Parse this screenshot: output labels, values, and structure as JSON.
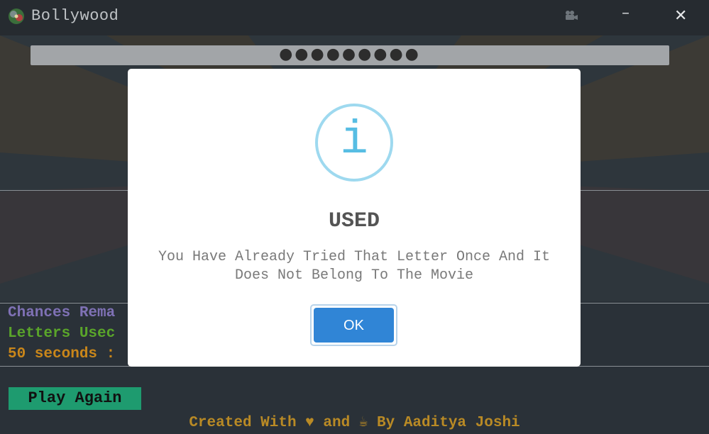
{
  "window": {
    "title": "Bollywood",
    "logo_icon": "app-logo-icon",
    "camera_icon": "video-camera-icon",
    "minimize_label": "–",
    "close_label": "✕"
  },
  "game": {
    "word_mask": "●●●●●●●●●",
    "chances_text": "Chances Rema",
    "letters_text": "Letters Usec",
    "timer_text": "50 seconds :",
    "play_again_label": "Play Again",
    "footer": "Created With ♥ and ☕ By Aaditya Joshi"
  },
  "modal": {
    "icon": "info-icon",
    "icon_glyph": "i",
    "title": "USED",
    "message": "You Have Already Tried That Letter Once And It Does Not Belong To The Movie",
    "ok_label": "OK"
  },
  "colors": {
    "chances": "#7f71b5",
    "letters": "#5aa52a",
    "timer": "#c9861a",
    "play_again_bg": "#1e9b6f",
    "ok_button": "#3085d6",
    "info_icon": "#57bde3"
  }
}
